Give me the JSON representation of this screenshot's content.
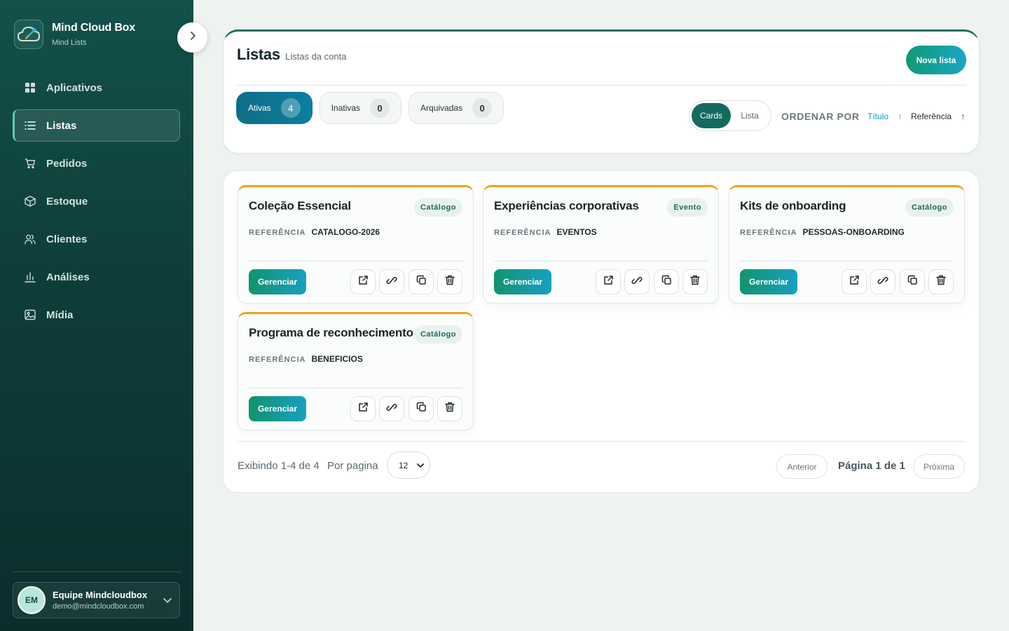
{
  "brand": {
    "title": "Mind Cloud Box",
    "subtitle": "Mind Lists"
  },
  "sidebar": {
    "items": [
      {
        "label": "Aplicativos",
        "icon": "grid-icon"
      },
      {
        "label": "Listas",
        "icon": "list-icon",
        "active": true
      },
      {
        "label": "Pedidos",
        "icon": "cart-icon"
      },
      {
        "label": "Estoque",
        "icon": "box-icon"
      },
      {
        "label": "Clientes",
        "icon": "users-icon"
      },
      {
        "label": "Análises",
        "icon": "bar-chart-icon"
      },
      {
        "label": "Mídia",
        "icon": "image-icon"
      }
    ]
  },
  "user": {
    "initials": "EM",
    "name": "Equipe Mindcloudbox",
    "email": "demo@mindcloudbox.com"
  },
  "header": {
    "title": "Listas",
    "subtitle": "Listas da conta",
    "new_button": "Nova lista",
    "tabs": [
      {
        "label": "Ativas",
        "count": "4",
        "active": true
      },
      {
        "label": "Inativas",
        "count": "0"
      },
      {
        "label": "Arquivadas",
        "count": "0"
      }
    ],
    "view": {
      "cards": "Cards",
      "list": "Lista",
      "selected": "Cards"
    },
    "order_label": "ORDENAR POR",
    "order_options": [
      {
        "label": "Título",
        "arrow": "↑",
        "active": true
      },
      {
        "label": "Referência",
        "arrow": "↑"
      }
    ]
  },
  "cards": [
    {
      "title": "Coleção Essencial",
      "badge": "Catálogo",
      "ref_label": "REFERÊNCIA",
      "ref_value": "CATALOGO-2026",
      "manage": "Gerenciar"
    },
    {
      "title": "Experiências corporativas",
      "badge": "Evento",
      "ref_label": "REFERÊNCIA",
      "ref_value": "EVENTOS",
      "manage": "Gerenciar"
    },
    {
      "title": "Kits de onboarding",
      "badge": "Catálogo",
      "ref_label": "REFERÊNCIA",
      "ref_value": "PESSOAS-ONBOARDING",
      "manage": "Gerenciar"
    },
    {
      "title": "Programa de reconhecimento",
      "badge": "Catálogo",
      "ref_label": "REFERÊNCIA",
      "ref_value": "BENEFICIOS",
      "manage": "Gerenciar"
    }
  ],
  "pagination": {
    "showing": "Exibindo 1-4 de 4",
    "per_page_label": "Por pagina",
    "per_page_value": "12",
    "prev": "Anterior",
    "info": "Página 1 de 1",
    "next": "Próxima"
  },
  "colors": {
    "sidebar": "#0e3d39",
    "accent": "#187065",
    "card_top": "#f0a119",
    "cta": "#109a76",
    "tab_active": "#0e6e86"
  }
}
